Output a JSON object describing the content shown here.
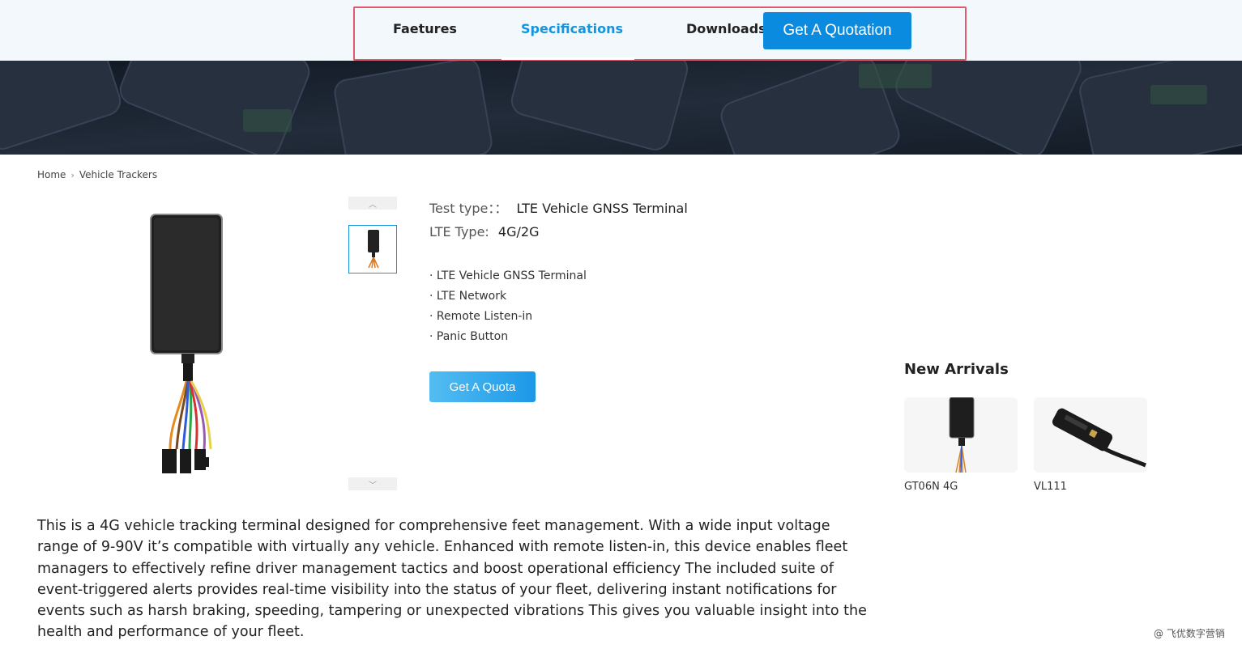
{
  "nav": {
    "features_label": "Faetures",
    "specifications_label": "Specifications",
    "downloads_label": "Downloads",
    "quote_label": "Get A Quotation",
    "accent_color": "#0a8be0",
    "highlight_color": "#e05a6c"
  },
  "breadcrumb": {
    "home": "Home",
    "separator_icon": "chevron-right-icon",
    "current": "Vehicle Trackers"
  },
  "product": {
    "test_type_label": "Test type：：",
    "test_type_value": "LTE Vehicle GNSS Terminal",
    "lte_type_label": "LTE Type:",
    "lte_type_value": "4G/2G",
    "features": [
      "· LTE Vehicle GNSS Terminal",
      "· LTE Network",
      "· Remote Listen-in",
      "· Panic Button"
    ],
    "quote_button": "Get A Quota",
    "thumb_up_icon": "chevron-up-icon",
    "thumb_down_icon": "chevron-down-icon"
  },
  "new_arrivals": {
    "title": "New Arrivals",
    "items": [
      {
        "name": "GT06N 4G"
      },
      {
        "name": "VL111"
      }
    ]
  },
  "description": "This is a 4G vehicle tracking terminal designed for comprehensive feet management. With a wide input voltage range of 9-90V it’s compatible with virtually any vehicle. Enhanced with remote listen-in, this device enables fleet managers to effectively refine driver management tactics and boost operational efficiency The included suite of event-triggered alerts provides real-time visibility into the status of your fleet, delivering instant notifications for events such as harsh braking, speeding, tampering or unexpected vibrations This gives you valuable insight into the health and performance of your fleet.",
  "watermark": "@ 飞优数字营销"
}
